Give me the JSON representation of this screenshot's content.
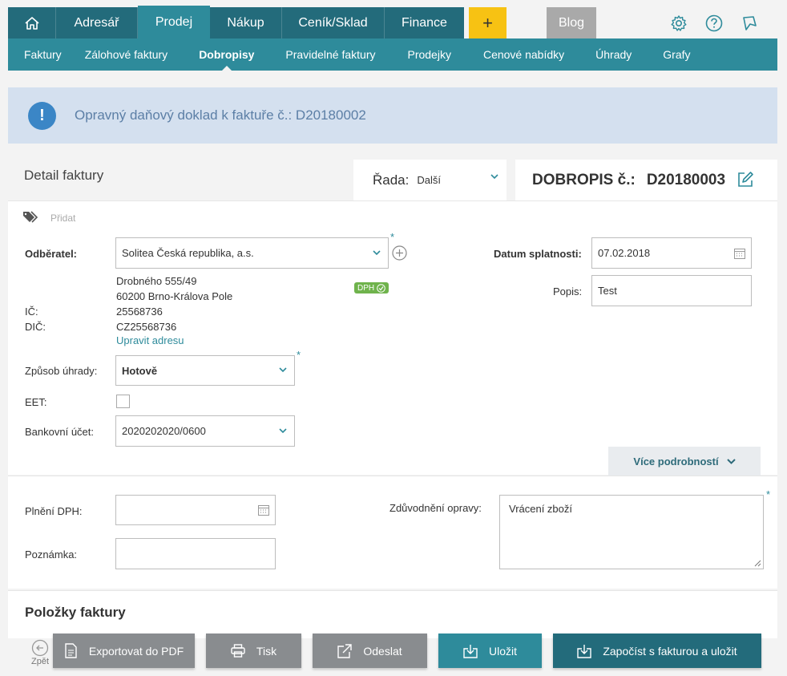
{
  "nav": {
    "tabs": [
      "Adresář",
      "Prodej",
      "Nákup",
      "Ceník/Sklad",
      "Finance"
    ],
    "active_tab": "Prodej",
    "plus_label": "+",
    "blog_label": "Blog"
  },
  "subnav": {
    "items": [
      "Faktury",
      "Zálohové faktury",
      "Dobropisy",
      "Pravidelné faktury",
      "Prodejky",
      "Cenové nabídky",
      "Úhrady",
      "Grafy"
    ],
    "active": "Dobropisy"
  },
  "alert": {
    "icon_label": "!",
    "text": "Opravný daňový doklad k faktuře č.: D20180002"
  },
  "header": {
    "detail_title": "Detail faktury",
    "rada_label": "Řada:",
    "rada_value": "Další",
    "dobropis_label": "DOBROPIS č.:",
    "dobropis_number": "D20180003"
  },
  "form": {
    "tag_label": "Přidat",
    "odberatel_label": "Odběratel:",
    "odberatel_value": "Solitea Česká republika, a.s.",
    "address_line1": "Drobného 555/49",
    "address_line2": "60200 Brno-Králova Pole",
    "ic_label": "IČ:",
    "ic_value": "25568736",
    "dic_label": "DIČ:",
    "dic_value": "CZ25568736",
    "dph_badge": "DPH",
    "edit_address_link": "Upravit adresu",
    "zpusob_label": "Způsob úhrady:",
    "zpusob_value": "Hotově",
    "eet_label": "EET:",
    "bank_label": "Bankovní účet:",
    "bank_value": "2020202020/0600",
    "splatnost_label": "Datum splatnosti:",
    "splatnost_value": "07.02.2018",
    "popis_label": "Popis:",
    "popis_value": "Test",
    "more_button": "Více podrobností",
    "plneni_label": "Plnění DPH:",
    "plneni_value": "",
    "poznamka_label": "Poznámka:",
    "poznamka_value": "",
    "zduvodneni_label": "Zdůvodnění opravy:",
    "zduvodneni_value": "Vrácení zboží",
    "required_mark": "*"
  },
  "items": {
    "title": "Položky faktury"
  },
  "footer": {
    "back_label": "Zpět",
    "export_pdf": "Exportovat do PDF",
    "print": "Tisk",
    "send": "Odeslat",
    "save": "Uložit",
    "offset_save": "Započíst s fakturou a uložit"
  },
  "colors": {
    "primary_dark": "#236b7b",
    "primary": "#2e8b9b",
    "accent_yellow": "#f7c213",
    "alert_bg": "#d4e0ef",
    "alert_icon": "#3b86c6"
  }
}
